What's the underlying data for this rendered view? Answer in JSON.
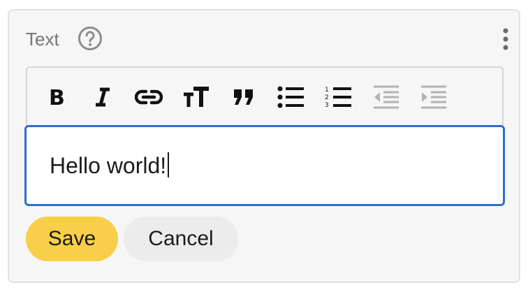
{
  "panel": {
    "title": "Text",
    "help_icon": "help-circle-icon",
    "menu_icon": "more-vertical-icon"
  },
  "toolbar": {
    "items": [
      {
        "name": "bold",
        "icon": "bold-icon"
      },
      {
        "name": "italic",
        "icon": "italic-icon"
      },
      {
        "name": "link",
        "icon": "link-icon"
      },
      {
        "name": "text-size",
        "icon": "text-size-icon"
      },
      {
        "name": "quote",
        "icon": "quote-icon"
      },
      {
        "name": "bulleted-list",
        "icon": "bulleted-list-icon"
      },
      {
        "name": "numbered-list",
        "icon": "numbered-list-icon"
      },
      {
        "name": "outdent",
        "icon": "outdent-icon",
        "disabled": true
      },
      {
        "name": "indent",
        "icon": "indent-icon",
        "disabled": true
      }
    ]
  },
  "editor": {
    "value": "Hello world!"
  },
  "actions": {
    "save_label": "Save",
    "cancel_label": "Cancel"
  },
  "colors": {
    "accent_save": "#f8cf48",
    "focus_border": "#2f6ecf",
    "disabled_icon": "#b3b3b3"
  }
}
